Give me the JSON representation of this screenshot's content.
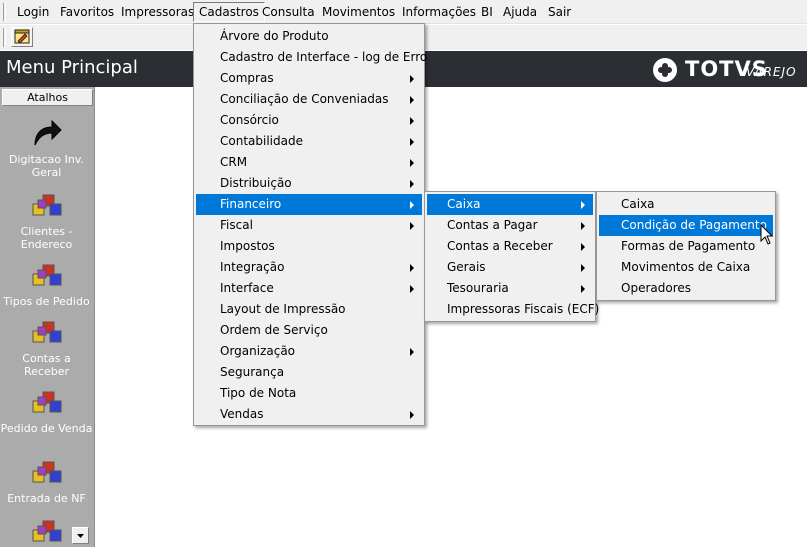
{
  "menubar": {
    "items": [
      {
        "label": "Login"
      },
      {
        "label": "Favoritos"
      },
      {
        "label": "Impressoras"
      },
      {
        "label": "Cadastros"
      },
      {
        "label": "Consulta"
      },
      {
        "label": "Movimentos"
      },
      {
        "label": "Informações"
      },
      {
        "label": "BI"
      },
      {
        "label": "Ajuda"
      },
      {
        "label": "Sair"
      }
    ]
  },
  "header": {
    "title": "Menu Principal",
    "logo_text": "TOTVS",
    "logo_sub": "VAREJO"
  },
  "sidebar": {
    "header": "Atalhos",
    "shortcuts": [
      {
        "label": "Digitacao Inv. Geral",
        "icon": "arrow-icon"
      },
      {
        "label": "Clientes - Endereco",
        "icon": "cubes-icon"
      },
      {
        "label": "Tipos de Pedido",
        "icon": "cubes-icon"
      },
      {
        "label": "Contas a Receber",
        "icon": "cubes-icon"
      },
      {
        "label": "Pedido de Venda",
        "icon": "cubes-icon"
      },
      {
        "label": "Entrada de NF",
        "icon": "cubes-icon"
      }
    ]
  },
  "menus": {
    "cadastros": [
      {
        "label": "Árvore do Produto",
        "submenu": false
      },
      {
        "label": "Cadastro de Interface - log de Erro",
        "submenu": false
      },
      {
        "label": "Compras",
        "submenu": true
      },
      {
        "label": "Conciliação de Conveniadas",
        "submenu": true
      },
      {
        "label": "Consórcio",
        "submenu": true
      },
      {
        "label": "Contabilidade",
        "submenu": true
      },
      {
        "label": "CRM",
        "submenu": true
      },
      {
        "label": "Distribuição",
        "submenu": true
      },
      {
        "label": "Financeiro",
        "submenu": true,
        "selected": true
      },
      {
        "label": "Fiscal",
        "submenu": true
      },
      {
        "label": "Impostos",
        "submenu": false
      },
      {
        "label": "Integração",
        "submenu": true
      },
      {
        "label": "Interface",
        "submenu": true
      },
      {
        "label": "Layout de Impressão",
        "submenu": false
      },
      {
        "label": "Ordem de Serviço",
        "submenu": false
      },
      {
        "label": "Organização",
        "submenu": true
      },
      {
        "label": "Segurança",
        "submenu": false
      },
      {
        "label": "Tipo de Nota",
        "submenu": false
      },
      {
        "label": "Vendas",
        "submenu": true
      }
    ],
    "financeiro": [
      {
        "label": "Caixa",
        "submenu": true,
        "selected": true
      },
      {
        "label": "Contas a Pagar",
        "submenu": true
      },
      {
        "label": "Contas a Receber",
        "submenu": true
      },
      {
        "label": "Gerais",
        "submenu": true
      },
      {
        "label": "Tesouraria",
        "submenu": true
      },
      {
        "label": "Impressoras Fiscais (ECF)",
        "submenu": false
      }
    ],
    "caixa": [
      {
        "label": "Caixa",
        "submenu": false
      },
      {
        "label": "Condição de Pagamento",
        "submenu": false,
        "selected": true
      },
      {
        "label": "Formas de Pagamento",
        "submenu": false
      },
      {
        "label": "Movimentos de Caixa",
        "submenu": false
      },
      {
        "label": "Operadores",
        "submenu": false
      }
    ]
  },
  "colors": {
    "accent": "#0078d7",
    "titlebar": "#2b2f33",
    "sidebar": "#ababab"
  }
}
